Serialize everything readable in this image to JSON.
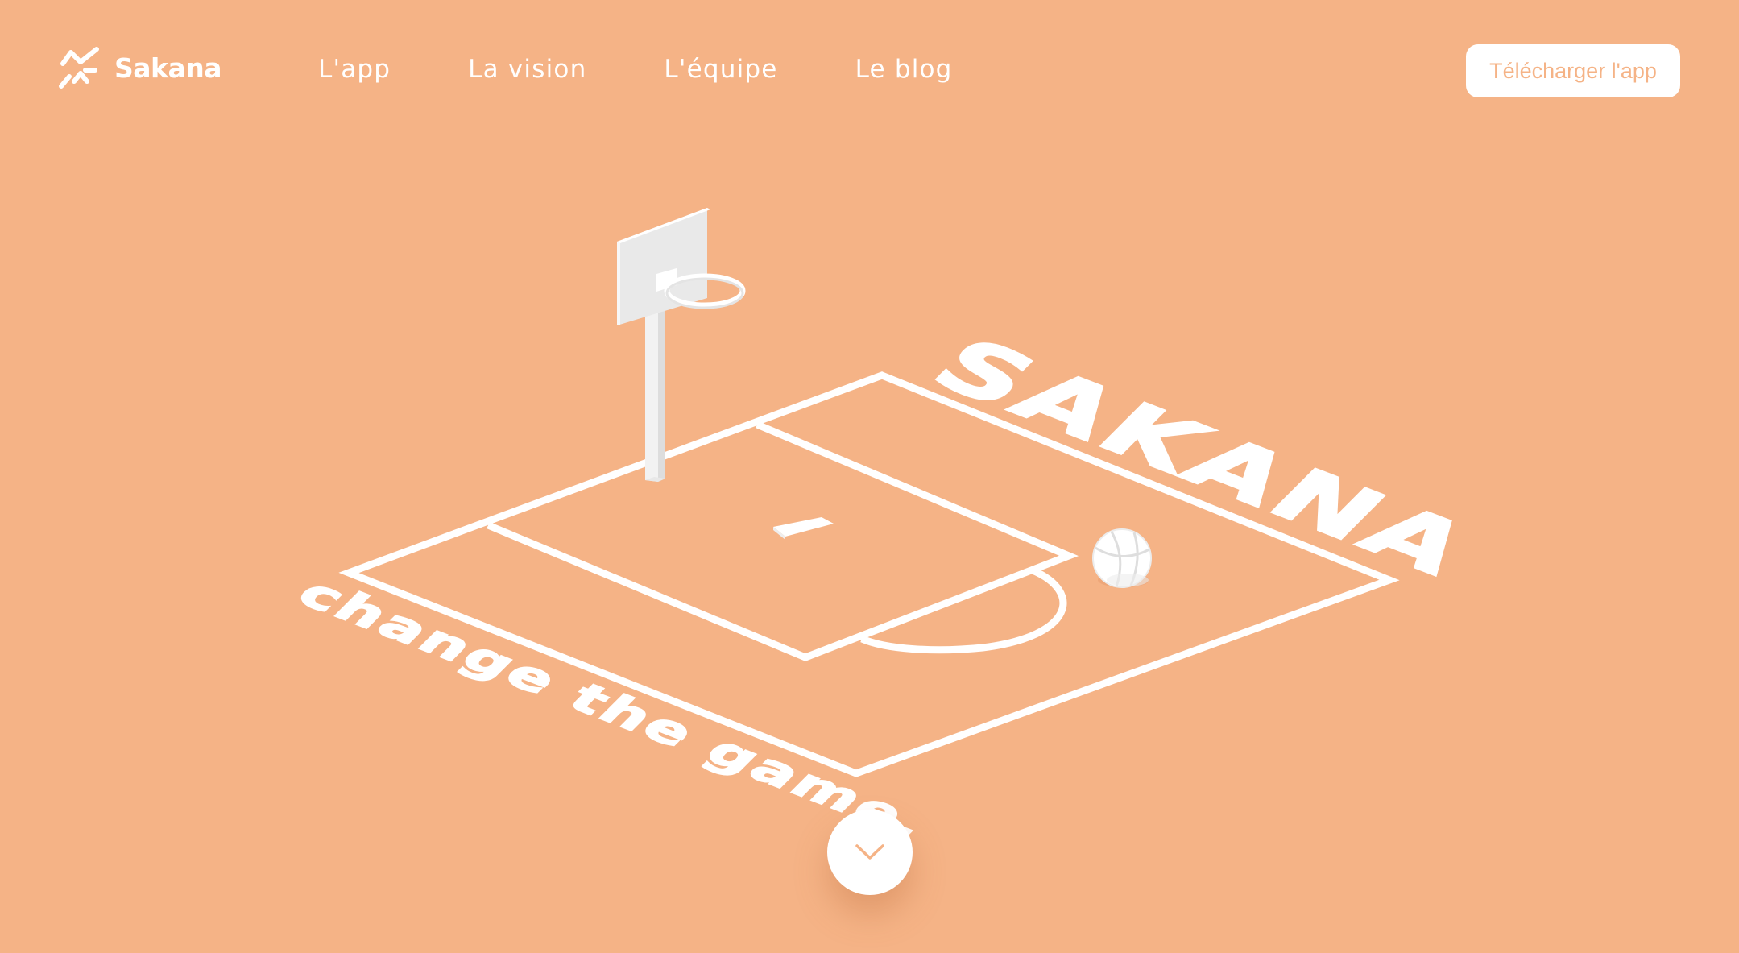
{
  "header": {
    "brand": "Sakana",
    "nav": {
      "app": "L'app",
      "vision": "La vision",
      "team": "L'équipe",
      "blog": "Le blog"
    },
    "download_label": "Télécharger l'app"
  },
  "hero": {
    "court_title": "SAKANA",
    "tagline": "change the game."
  },
  "icons": {
    "logo": "sakana-logo-icon",
    "scroll": "chevron-down-icon"
  },
  "colors": {
    "background": "#f5b386",
    "foreground": "#ffffff",
    "accent_text": "#f5b386"
  }
}
